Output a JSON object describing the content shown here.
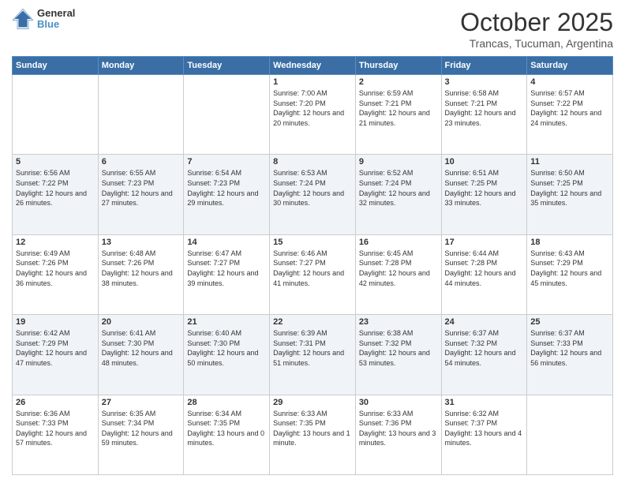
{
  "header": {
    "logo": {
      "line1": "General",
      "line2": "Blue"
    },
    "title": "October 2025",
    "subtitle": "Trancas, Tucuman, Argentina"
  },
  "weekdays": [
    "Sunday",
    "Monday",
    "Tuesday",
    "Wednesday",
    "Thursday",
    "Friday",
    "Saturday"
  ],
  "weeks": [
    {
      "days": [
        {
          "num": "",
          "sunrise": "",
          "sunset": "",
          "daylight": "",
          "empty": true
        },
        {
          "num": "",
          "sunrise": "",
          "sunset": "",
          "daylight": "",
          "empty": true
        },
        {
          "num": "",
          "sunrise": "",
          "sunset": "",
          "daylight": "",
          "empty": true
        },
        {
          "num": "1",
          "sunrise": "Sunrise: 7:00 AM",
          "sunset": "Sunset: 7:20 PM",
          "daylight": "Daylight: 12 hours and 20 minutes."
        },
        {
          "num": "2",
          "sunrise": "Sunrise: 6:59 AM",
          "sunset": "Sunset: 7:21 PM",
          "daylight": "Daylight: 12 hours and 21 minutes."
        },
        {
          "num": "3",
          "sunrise": "Sunrise: 6:58 AM",
          "sunset": "Sunset: 7:21 PM",
          "daylight": "Daylight: 12 hours and 23 minutes."
        },
        {
          "num": "4",
          "sunrise": "Sunrise: 6:57 AM",
          "sunset": "Sunset: 7:22 PM",
          "daylight": "Daylight: 12 hours and 24 minutes."
        }
      ]
    },
    {
      "days": [
        {
          "num": "5",
          "sunrise": "Sunrise: 6:56 AM",
          "sunset": "Sunset: 7:22 PM",
          "daylight": "Daylight: 12 hours and 26 minutes."
        },
        {
          "num": "6",
          "sunrise": "Sunrise: 6:55 AM",
          "sunset": "Sunset: 7:23 PM",
          "daylight": "Daylight: 12 hours and 27 minutes."
        },
        {
          "num": "7",
          "sunrise": "Sunrise: 6:54 AM",
          "sunset": "Sunset: 7:23 PM",
          "daylight": "Daylight: 12 hours and 29 minutes."
        },
        {
          "num": "8",
          "sunrise": "Sunrise: 6:53 AM",
          "sunset": "Sunset: 7:24 PM",
          "daylight": "Daylight: 12 hours and 30 minutes."
        },
        {
          "num": "9",
          "sunrise": "Sunrise: 6:52 AM",
          "sunset": "Sunset: 7:24 PM",
          "daylight": "Daylight: 12 hours and 32 minutes."
        },
        {
          "num": "10",
          "sunrise": "Sunrise: 6:51 AM",
          "sunset": "Sunset: 7:25 PM",
          "daylight": "Daylight: 12 hours and 33 minutes."
        },
        {
          "num": "11",
          "sunrise": "Sunrise: 6:50 AM",
          "sunset": "Sunset: 7:25 PM",
          "daylight": "Daylight: 12 hours and 35 minutes."
        }
      ]
    },
    {
      "days": [
        {
          "num": "12",
          "sunrise": "Sunrise: 6:49 AM",
          "sunset": "Sunset: 7:26 PM",
          "daylight": "Daylight: 12 hours and 36 minutes."
        },
        {
          "num": "13",
          "sunrise": "Sunrise: 6:48 AM",
          "sunset": "Sunset: 7:26 PM",
          "daylight": "Daylight: 12 hours and 38 minutes."
        },
        {
          "num": "14",
          "sunrise": "Sunrise: 6:47 AM",
          "sunset": "Sunset: 7:27 PM",
          "daylight": "Daylight: 12 hours and 39 minutes."
        },
        {
          "num": "15",
          "sunrise": "Sunrise: 6:46 AM",
          "sunset": "Sunset: 7:27 PM",
          "daylight": "Daylight: 12 hours and 41 minutes."
        },
        {
          "num": "16",
          "sunrise": "Sunrise: 6:45 AM",
          "sunset": "Sunset: 7:28 PM",
          "daylight": "Daylight: 12 hours and 42 minutes."
        },
        {
          "num": "17",
          "sunrise": "Sunrise: 6:44 AM",
          "sunset": "Sunset: 7:28 PM",
          "daylight": "Daylight: 12 hours and 44 minutes."
        },
        {
          "num": "18",
          "sunrise": "Sunrise: 6:43 AM",
          "sunset": "Sunset: 7:29 PM",
          "daylight": "Daylight: 12 hours and 45 minutes."
        }
      ]
    },
    {
      "days": [
        {
          "num": "19",
          "sunrise": "Sunrise: 6:42 AM",
          "sunset": "Sunset: 7:29 PM",
          "daylight": "Daylight: 12 hours and 47 minutes."
        },
        {
          "num": "20",
          "sunrise": "Sunrise: 6:41 AM",
          "sunset": "Sunset: 7:30 PM",
          "daylight": "Daylight: 12 hours and 48 minutes."
        },
        {
          "num": "21",
          "sunrise": "Sunrise: 6:40 AM",
          "sunset": "Sunset: 7:30 PM",
          "daylight": "Daylight: 12 hours and 50 minutes."
        },
        {
          "num": "22",
          "sunrise": "Sunrise: 6:39 AM",
          "sunset": "Sunset: 7:31 PM",
          "daylight": "Daylight: 12 hours and 51 minutes."
        },
        {
          "num": "23",
          "sunrise": "Sunrise: 6:38 AM",
          "sunset": "Sunset: 7:32 PM",
          "daylight": "Daylight: 12 hours and 53 minutes."
        },
        {
          "num": "24",
          "sunrise": "Sunrise: 6:37 AM",
          "sunset": "Sunset: 7:32 PM",
          "daylight": "Daylight: 12 hours and 54 minutes."
        },
        {
          "num": "25",
          "sunrise": "Sunrise: 6:37 AM",
          "sunset": "Sunset: 7:33 PM",
          "daylight": "Daylight: 12 hours and 56 minutes."
        }
      ]
    },
    {
      "days": [
        {
          "num": "26",
          "sunrise": "Sunrise: 6:36 AM",
          "sunset": "Sunset: 7:33 PM",
          "daylight": "Daylight: 12 hours and 57 minutes."
        },
        {
          "num": "27",
          "sunrise": "Sunrise: 6:35 AM",
          "sunset": "Sunset: 7:34 PM",
          "daylight": "Daylight: 12 hours and 59 minutes."
        },
        {
          "num": "28",
          "sunrise": "Sunrise: 6:34 AM",
          "sunset": "Sunset: 7:35 PM",
          "daylight": "Daylight: 13 hours and 0 minutes."
        },
        {
          "num": "29",
          "sunrise": "Sunrise: 6:33 AM",
          "sunset": "Sunset: 7:35 PM",
          "daylight": "Daylight: 13 hours and 1 minute."
        },
        {
          "num": "30",
          "sunrise": "Sunrise: 6:33 AM",
          "sunset": "Sunset: 7:36 PM",
          "daylight": "Daylight: 13 hours and 3 minutes."
        },
        {
          "num": "31",
          "sunrise": "Sunrise: 6:32 AM",
          "sunset": "Sunset: 7:37 PM",
          "daylight": "Daylight: 13 hours and 4 minutes."
        },
        {
          "num": "",
          "sunrise": "",
          "sunset": "",
          "daylight": "",
          "empty": true
        }
      ]
    }
  ]
}
